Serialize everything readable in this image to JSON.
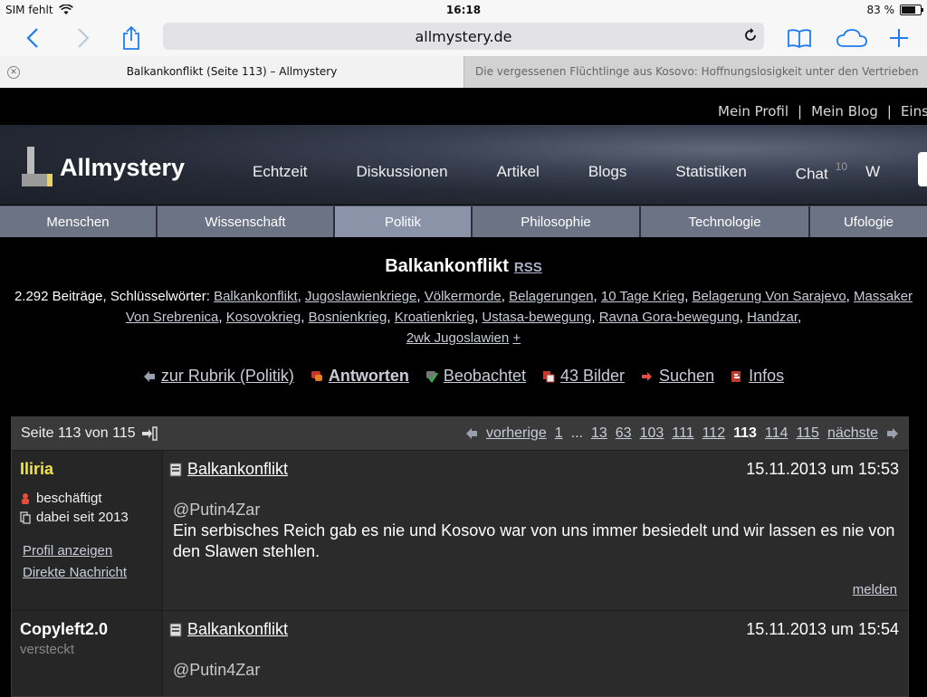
{
  "ios": {
    "carrier": "SIM fehlt",
    "time": "16:18",
    "battery": "83 %",
    "battery_level": 0.83
  },
  "safari": {
    "url": "allmystery.de",
    "tabs": [
      {
        "title": "Balkankonflikt (Seite 113) – Allmystery",
        "active": true
      },
      {
        "title": "Die vergessenen Flüchtlinge aus Kosovo: Hoffnungslosigkeit unter den Vertriebenen...",
        "active": false
      }
    ]
  },
  "site": {
    "userlinks": [
      "Mein Profil",
      "Mein Blog",
      "Eins"
    ],
    "logo_text": "Allmystery",
    "nav": [
      {
        "label": "Echtzeit"
      },
      {
        "label": "Diskussionen"
      },
      {
        "label": "Artikel"
      },
      {
        "label": "Blogs"
      },
      {
        "label": "Statistiken"
      },
      {
        "label": "Chat",
        "badge": "10"
      },
      {
        "label": "W"
      }
    ],
    "categories": [
      {
        "label": "Menschen",
        "active": false
      },
      {
        "label": "Wissenschaft",
        "active": false
      },
      {
        "label": "Politik",
        "active": true
      },
      {
        "label": "Philosophie",
        "active": false
      },
      {
        "label": "Technologie",
        "active": false
      },
      {
        "label": "Ufologie",
        "active": false
      }
    ]
  },
  "topic": {
    "title": "Balkankonflikt",
    "rss": "RSS",
    "post_count": "2.292 Beiträge, Schlüsselwörter:",
    "keywords": [
      "Balkankonflikt",
      "Jugoslawienkriege",
      "Völkermorde",
      "Belagerungen",
      "10 Tage Krieg",
      "Belagerung Von Sarajevo",
      "Massaker Von Srebrenica",
      "Kosovokrieg",
      "Bosnienkrieg",
      "Kroatienkrieg",
      "Ustasa-bewegung",
      "Ravna Gora-bewegung",
      "Handzar",
      "2wk Jugoslawien"
    ],
    "add_keyword": "+",
    "actions": [
      {
        "label": "zur Rubrik (Politik)",
        "icon": "arrow-left-icon"
      },
      {
        "label": "Antworten",
        "icon": "reply-icon",
        "bold": true
      },
      {
        "label": "Beobachtet",
        "icon": "watch-check-icon"
      },
      {
        "label": "43 Bilder",
        "icon": "images-icon"
      },
      {
        "label": "Suchen",
        "icon": "search-arrow-icon"
      },
      {
        "label": "Infos",
        "icon": "info-icon"
      }
    ]
  },
  "pagination": {
    "info": "Seite 113 von 115",
    "prev": "vorherige",
    "pages": [
      "1",
      "...",
      "13",
      "63",
      "103",
      "111",
      "112",
      "113",
      "114",
      "115"
    ],
    "current": "113",
    "next": "nächste"
  },
  "posts": [
    {
      "user": "Iliria",
      "user_color": "#f2e34a",
      "status": "beschäftigt",
      "since": "dabei seit 2013",
      "profile_link": "Profil anzeigen",
      "message_link": "Direkte Nachricht",
      "title": "Balkankonflikt",
      "date": "15.11.2013 um 15:53",
      "mention": "@Putin4Zar",
      "text": "Ein serbisches Reich gab es nie und Kosovo war von uns immer besiedelt und wir lassen es nie von den Slawen stehlen.",
      "report": "melden"
    },
    {
      "user": "Copyleft2.0",
      "user_color": "#ffffff",
      "status": "versteckt",
      "title": "Balkankonflikt",
      "date": "15.11.2013 um 15:54",
      "mention": "@Putin4Zar"
    }
  ]
}
